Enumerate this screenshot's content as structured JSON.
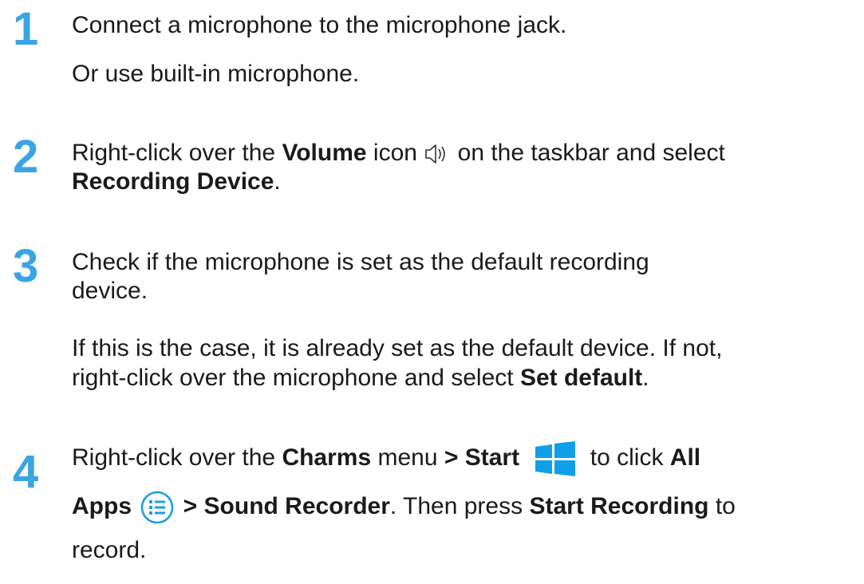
{
  "steps": [
    {
      "number": "1",
      "lines": [
        [
          "Connect a microphone to the microphone jack."
        ],
        [
          "Or use built-in microphone."
        ]
      ]
    },
    {
      "number": "2",
      "line1_a": "Right-click over the ",
      "line1_b": "Volume",
      "line1_c": " icon ",
      "line1_d": " on the taskbar and select",
      "line2_a": "Recording Device",
      "line2_b": "."
    },
    {
      "number": "3",
      "line1": "Check if the microphone is set as the default recording",
      "line2": "device.",
      "line3": "If this is the case, it is already set as the default device. If not,",
      "line4_a": "right-click over the microphone and select ",
      "line4_b": "Set default",
      "line4_c": "."
    },
    {
      "number": "4",
      "line1_a": "Right-click over the ",
      "line1_b": "Charms",
      "line1_c": " menu ",
      "line1_d": "> Start",
      "line1_e": " to click ",
      "line1_f": "All",
      "line2_a": "Apps",
      "line2_b": " > Sound Recorder",
      "line2_c": ". Then press ",
      "line2_d": "Start Recording",
      "line2_e": " to",
      "line3": "record."
    }
  ],
  "icons": {
    "volume": "speaker-icon",
    "start": "windows-start-icon",
    "all_apps": "all-apps-icon"
  },
  "colors": {
    "accent": "#3ba4e4",
    "start_tile": "#0fa0e8",
    "text": "#1a1a1a"
  }
}
